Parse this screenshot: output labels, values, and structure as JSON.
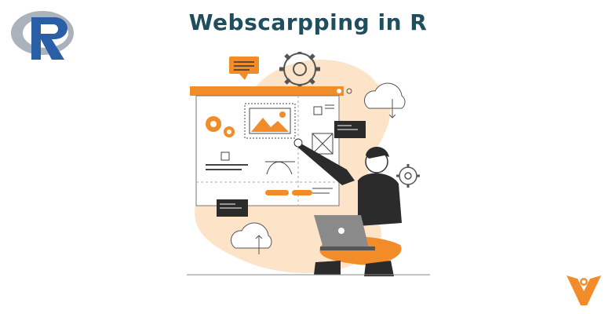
{
  "header": {
    "title": "Webscarpping in R"
  },
  "logos": {
    "r_logo_letter": "R",
    "r_logo_icon": "r-language-logo",
    "brand_logo_icon": "orange-v-person-logo"
  },
  "colors": {
    "title": "#1f4e5f",
    "accent_orange": "#f28c28",
    "peach_blob": "#fde3c8",
    "dark": "#2b2b2b",
    "r_blue": "#2a5fa8",
    "r_grey": "#9aa3ad"
  },
  "illustration": {
    "icon": "web-developer-illustration"
  }
}
